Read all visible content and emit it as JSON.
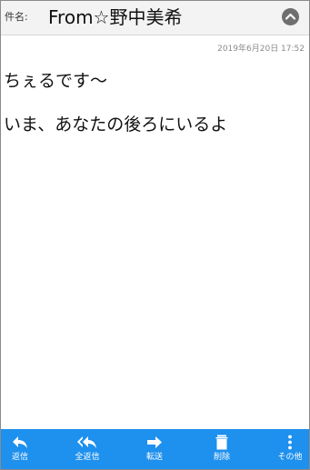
{
  "header": {
    "subject_label": "件名:",
    "subject": "From☆野中美希"
  },
  "message": {
    "date": "2019年6月20日 17:52",
    "lines": [
      "ちぇるです〜",
      "いま、あなたの後ろにいるよ"
    ]
  },
  "toolbar": {
    "items": [
      {
        "label": "返信",
        "icon": "reply-icon"
      },
      {
        "label": "全返信",
        "icon": "reply-all-icon"
      },
      {
        "label": "転送",
        "icon": "forward-icon"
      },
      {
        "label": "削除",
        "icon": "trash-icon"
      },
      {
        "label": "その他",
        "icon": "more-vertical-icon"
      }
    ]
  },
  "colors": {
    "toolbar_background": "#1e90ee",
    "header_background": "#f3f3f3",
    "collapse_button": "#6f6f6f"
  }
}
